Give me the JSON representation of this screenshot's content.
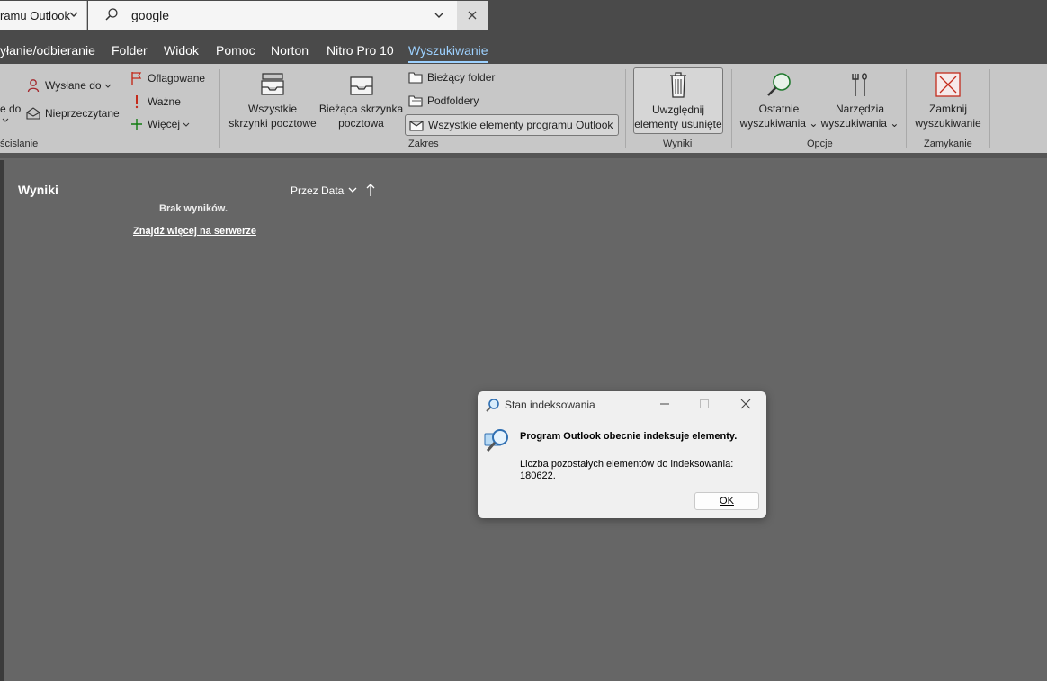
{
  "search_bar": {
    "scope": "ramu Outlook",
    "query": "google",
    "clear_icon": "close-icon"
  },
  "tabs": [
    "yłanie/odbieranie",
    "Folder",
    "Widok",
    "Pomoc",
    "Norton",
    "Nitro Pro 10",
    "Wyszukiwanie"
  ],
  "active_tab": "Wyszukiwanie",
  "ribbon": {
    "refine": {
      "partial_big": "e do",
      "sent_to": "Wysłane do",
      "unread": "Nieprzeczytane",
      "flagged": "Oflagowane",
      "important": "Ważne",
      "more": "Więcej",
      "group_label": "ścislanie"
    },
    "scope": {
      "all_mailboxes_1": "Wszystkie",
      "all_mailboxes_2": "skrzynki pocztowe",
      "current_mailbox_1": "Bieżąca skrzynka",
      "current_mailbox_2": "pocztowa",
      "current_folder": "Bieżący folder",
      "subfolders": "Podfoldery",
      "all_outlook_items": "Wszystkie elementy programu Outlook",
      "group_label": "Zakres"
    },
    "results": {
      "include_deleted_1": "Uwzględnij",
      "include_deleted_2": "elementy usunięte",
      "group_label": "Wyniki"
    },
    "options": {
      "recent_1": "Ostatnie",
      "recent_2": "wyszukiwania",
      "tools_1": "Narzędzia",
      "tools_2": "wyszukiwania",
      "group_label": "Opcje"
    },
    "close": {
      "close_1": "Zamknij",
      "close_2": "wyszukiwanie",
      "group_label": "Zamykanie"
    }
  },
  "results_pane": {
    "title": "Wyniki",
    "sort_label": "Przez Data",
    "empty_text": "Brak wyników.",
    "find_more_link": "Znajdź więcej na serwerze"
  },
  "dialog": {
    "title": "Stan indeksowania",
    "message": "Program Outlook obecnie indeksuje elementy.",
    "detail_line1": "Liczba pozostałych elementów do indeksowania:",
    "detail_line2": "180622.",
    "ok_label": "OK"
  },
  "colors": {
    "accent": "#9dd1ff",
    "background": "#666666",
    "ribbon": "#c7c7c7",
    "flag": "#c42b1c"
  }
}
